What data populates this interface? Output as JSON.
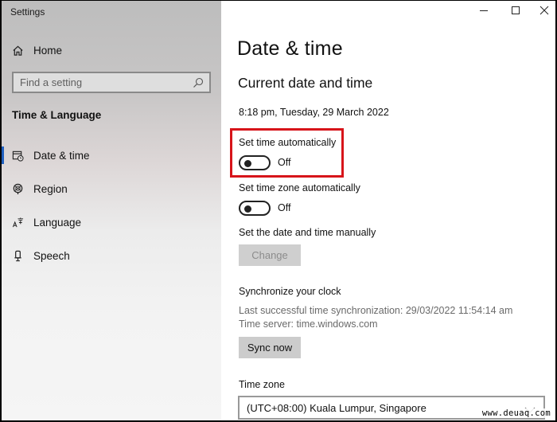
{
  "window": {
    "app_title": "Settings",
    "controls": {
      "minimize": "minimize-icon",
      "maximize": "maximize-icon",
      "close": "close-icon"
    }
  },
  "sidebar": {
    "home": {
      "label": "Home",
      "icon": "home-icon"
    },
    "search": {
      "placeholder": "Find a setting",
      "value": "",
      "icon": "search-icon"
    },
    "section_title": "Time & Language",
    "items": [
      {
        "label": "Date & time",
        "icon": "calendar-clock-icon",
        "active": true
      },
      {
        "label": "Region",
        "icon": "globe-icon",
        "active": false
      },
      {
        "label": "Language",
        "icon": "language-icon",
        "active": false
      },
      {
        "label": "Speech",
        "icon": "microphone-icon",
        "active": false
      }
    ],
    "accent_color": "#1f5fbf"
  },
  "main": {
    "page_title": "Date & time",
    "current_section_title": "Current date and time",
    "current_datetime": "8:18 pm, Tuesday, 29 March 2022",
    "set_time_auto": {
      "label": "Set time automatically",
      "state": "Off",
      "on": false,
      "highlighted": true
    },
    "set_timezone_auto": {
      "label": "Set time zone automatically",
      "state": "Off",
      "on": false
    },
    "manual": {
      "label": "Set the date and time manually",
      "button": "Change",
      "button_enabled": false
    },
    "sync": {
      "title": "Synchronize your clock",
      "last_sync": "Last successful time synchronization: 29/03/2022 11:54:14 am",
      "time_server": "Time server: time.windows.com",
      "button": "Sync now"
    },
    "time_zone": {
      "label": "Time zone",
      "selected": "(UTC+08:00) Kuala Lumpur, Singapore"
    },
    "highlight_color": "#d7141a"
  },
  "watermark": "www.deuaq.com"
}
